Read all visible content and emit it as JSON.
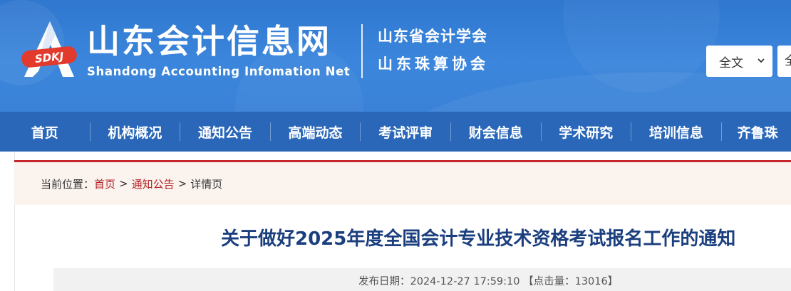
{
  "header": {
    "logo_text": "SDKJ",
    "site_title": "山东会计信息网",
    "site_subtitle": "Shandong Accounting Infomation Net",
    "association_1": "山东省会计学会",
    "association_2": "山东珠算协会",
    "search": {
      "scope_selected": "全文",
      "input_value": "全"
    }
  },
  "nav": {
    "items": [
      "首页",
      "机构概况",
      "通知公告",
      "高端动态",
      "考试评审",
      "财会信息",
      "学术研究",
      "培训信息",
      "齐鲁珠"
    ]
  },
  "breadcrumb": {
    "label": "当前位置：",
    "home": "首页",
    "section": "通知公告",
    "current": "详情页",
    "separator": ">"
  },
  "article": {
    "title": "关于做好2025年度全国会计专业技术资格考试报名工作的通知",
    "meta": "发布日期：2024-12-27 17:59:10 【点击量：13016】"
  },
  "colors": {
    "header_blue": "#3a82d8",
    "nav_blue": "#2a67b8",
    "accent_red": "#c4272b",
    "title_navy": "#1b3f7e"
  }
}
